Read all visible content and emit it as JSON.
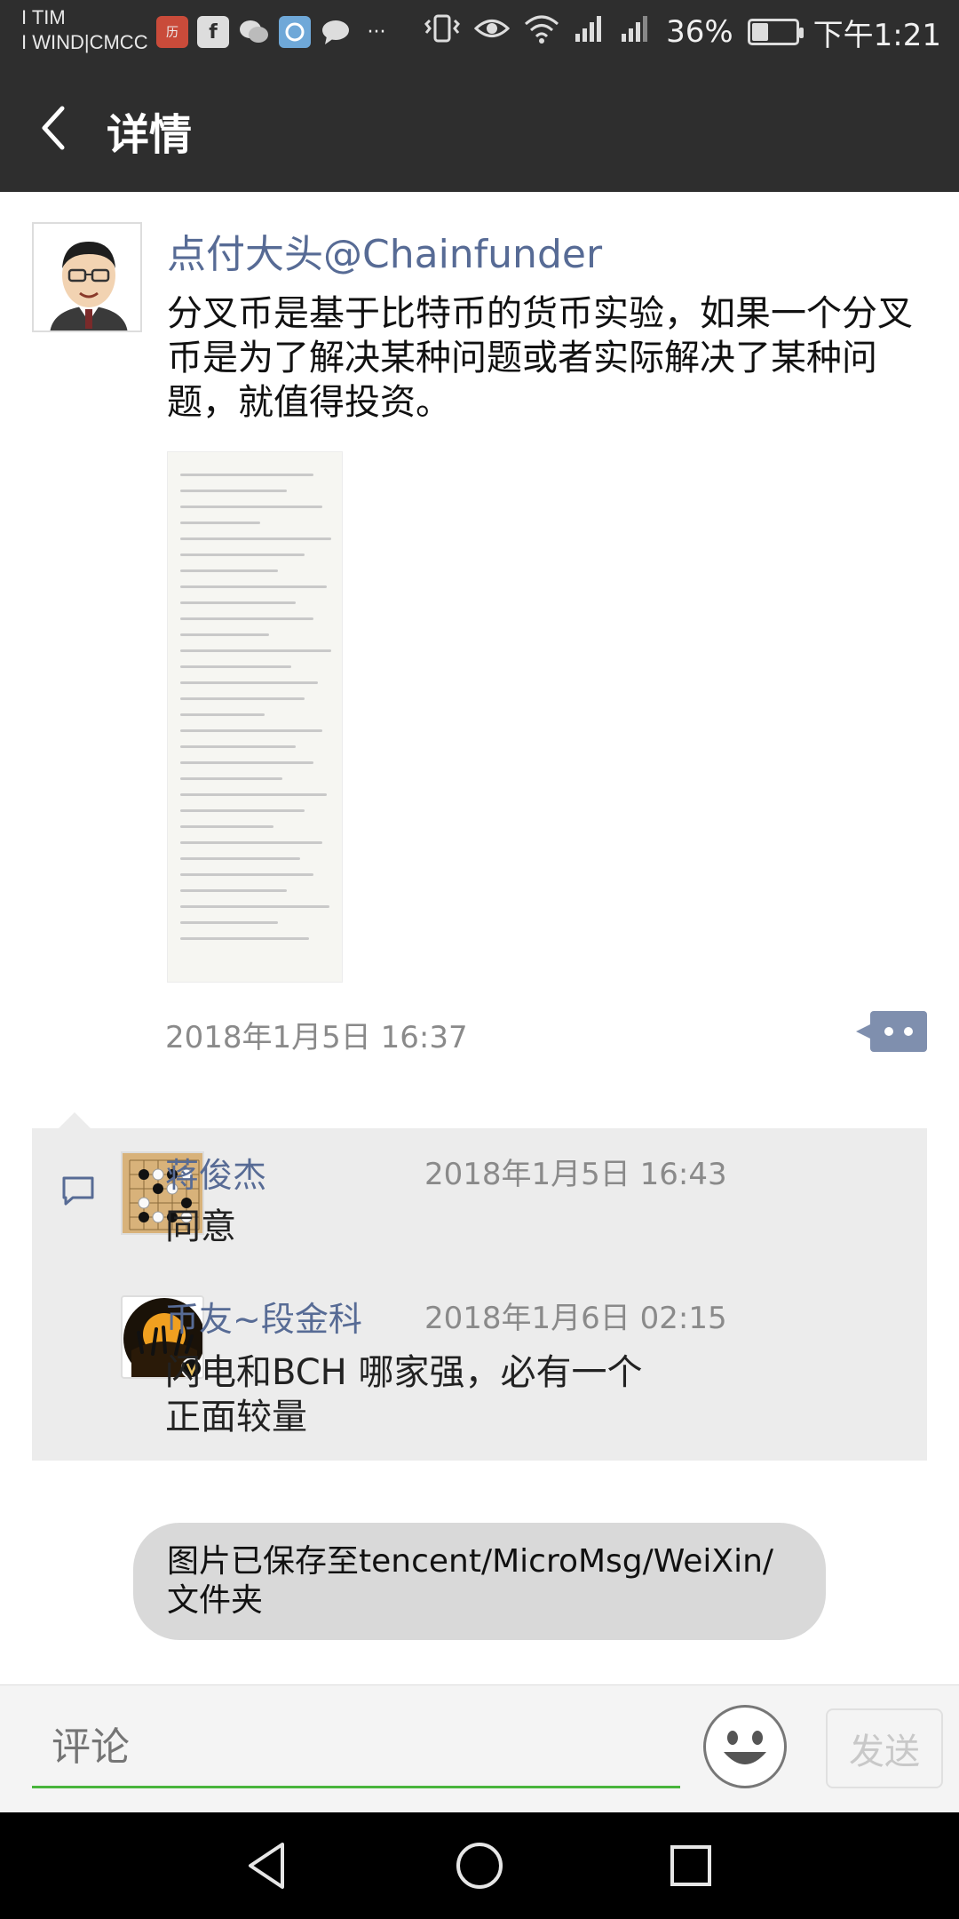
{
  "status_bar": {
    "carrier_line1": "I TIM",
    "carrier_line2": "I WIND|CMCC",
    "app_icons": [
      "calendar-app-icon",
      "facebook-icon",
      "wechat-icon",
      "qq-browser-icon",
      "message-icon"
    ],
    "more": "···",
    "battery_percent": "36%",
    "battery_level": 0.36,
    "time": "下午1:21",
    "text_color": "#e8e8e8"
  },
  "header": {
    "title": "详情",
    "background": "#2e2e2e"
  },
  "post": {
    "author": "点付大头@Chainfunder",
    "text": "分叉币是基于比特币的货币实验，如果一个分叉币是为了解决某种问题或者实际解决了某种问题，就值得投资。",
    "timestamp": "2018年1月5日 16:37",
    "name_color": "#576b95"
  },
  "comments": [
    {
      "name": "蒋俊杰",
      "time": "2018年1月5日 16:43",
      "text": "同意"
    },
    {
      "name": "币友~段金科",
      "time": "2018年1月6日 02:15",
      "text": "闪电和BCH 哪家强，必有一个正面较量"
    }
  ],
  "toast": {
    "text": "图片已保存至tencent/MicroMsg/WeiXin/文件夹"
  },
  "input": {
    "placeholder": "评论",
    "send_label": "发送",
    "accent": "#48b53c"
  }
}
